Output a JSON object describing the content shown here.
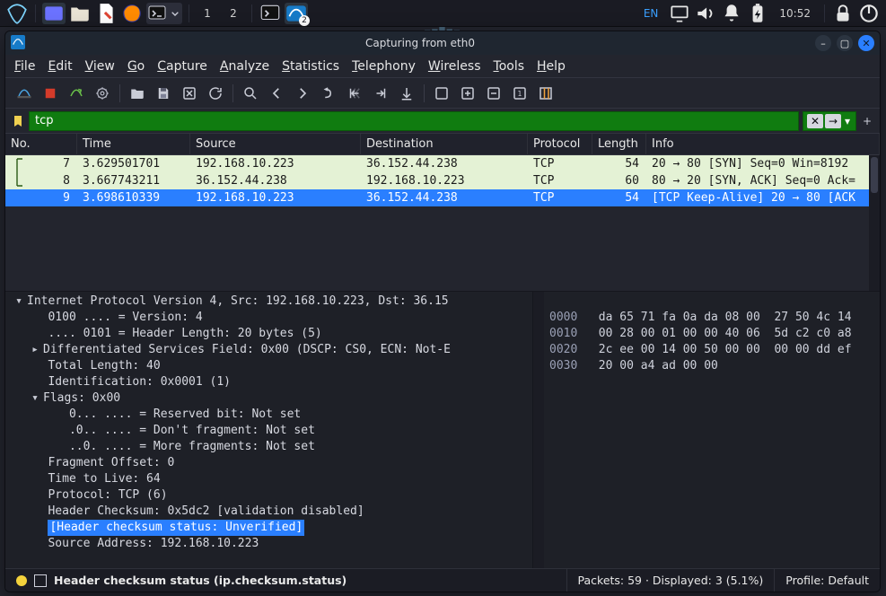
{
  "taskbar": {
    "lang": "EN",
    "clock": "10:52",
    "workspaces": [
      "1",
      "2"
    ]
  },
  "window": {
    "title": "Capturing from eth0"
  },
  "menu": {
    "file": "File",
    "edit": "Edit",
    "view": "View",
    "go": "Go",
    "capture": "Capture",
    "analyze": "Analyze",
    "statistics": "Statistics",
    "telephony": "Telephony",
    "wireless": "Wireless",
    "tools": "Tools",
    "help": "Help"
  },
  "filter": {
    "value": "tcp",
    "add": "+"
  },
  "columns": {
    "no": "No.",
    "time": "Time",
    "source": "Source",
    "destination": "Destination",
    "protocol": "Protocol",
    "length": "Length",
    "info": "Info"
  },
  "packets": [
    {
      "no": "7",
      "time": "3.629501701",
      "src": "192.168.10.223",
      "dst": "36.152.44.238",
      "proto": "TCP",
      "len": "54",
      "info": "20 → 80 [SYN] Seq=0 Win=8192"
    },
    {
      "no": "8",
      "time": "3.667743211",
      "src": "36.152.44.238",
      "dst": "192.168.10.223",
      "proto": "TCP",
      "len": "60",
      "info": "80 → 20 [SYN, ACK] Seq=0 Ack="
    },
    {
      "no": "9",
      "time": "3.698610339",
      "src": "192.168.10.223",
      "dst": "36.152.44.238",
      "proto": "TCP",
      "len": "54",
      "info": "[TCP Keep-Alive] 20 → 80 [ACK"
    }
  ],
  "details": {
    "ipv4_header": "Internet Protocol Version 4, Src: 192.168.10.223, Dst: 36.15",
    "version": "0100 .... = Version: 4",
    "hdr_len": ".... 0101 = Header Length: 20 bytes (5)",
    "ds_field": "Differentiated Services Field: 0x00 (DSCP: CS0, ECN: Not-E",
    "total_len": "Total Length: 40",
    "ident": "Identification: 0x0001 (1)",
    "flags": "Flags: 0x00",
    "flag_res": "0... .... = Reserved bit: Not set",
    "flag_df": ".0.. .... = Don't fragment: Not set",
    "flag_mf": "..0. .... = More fragments: Not set",
    "frag_off": "Fragment Offset: 0",
    "ttl": "Time to Live: 64",
    "proto": "Protocol: TCP (6)",
    "checksum": "Header Checksum: 0x5dc2 [validation disabled]",
    "checksum_status": "[Header checksum status: Unverified]",
    "src_addr": "Source Address: 192.168.10.223"
  },
  "hex": {
    "lines": [
      {
        "off": "0000",
        "b": "da 65 71 fa 0a da 08 00  27 50 4c 14 "
      },
      {
        "off": "0010",
        "b": "00 28 00 01 00 00 40 06  5d c2 c0 a8 "
      },
      {
        "off": "0020",
        "b": "2c ee 00 14 00 50 00 00  00 00 dd ef "
      },
      {
        "off": "0030",
        "b": "20 00 a4 ad 00 00"
      }
    ]
  },
  "status": {
    "field": "Header checksum status (ip.checksum.status)",
    "packets": "Packets: 59 · Displayed: 3 (5.1%)",
    "profile": "Profile: Default"
  }
}
